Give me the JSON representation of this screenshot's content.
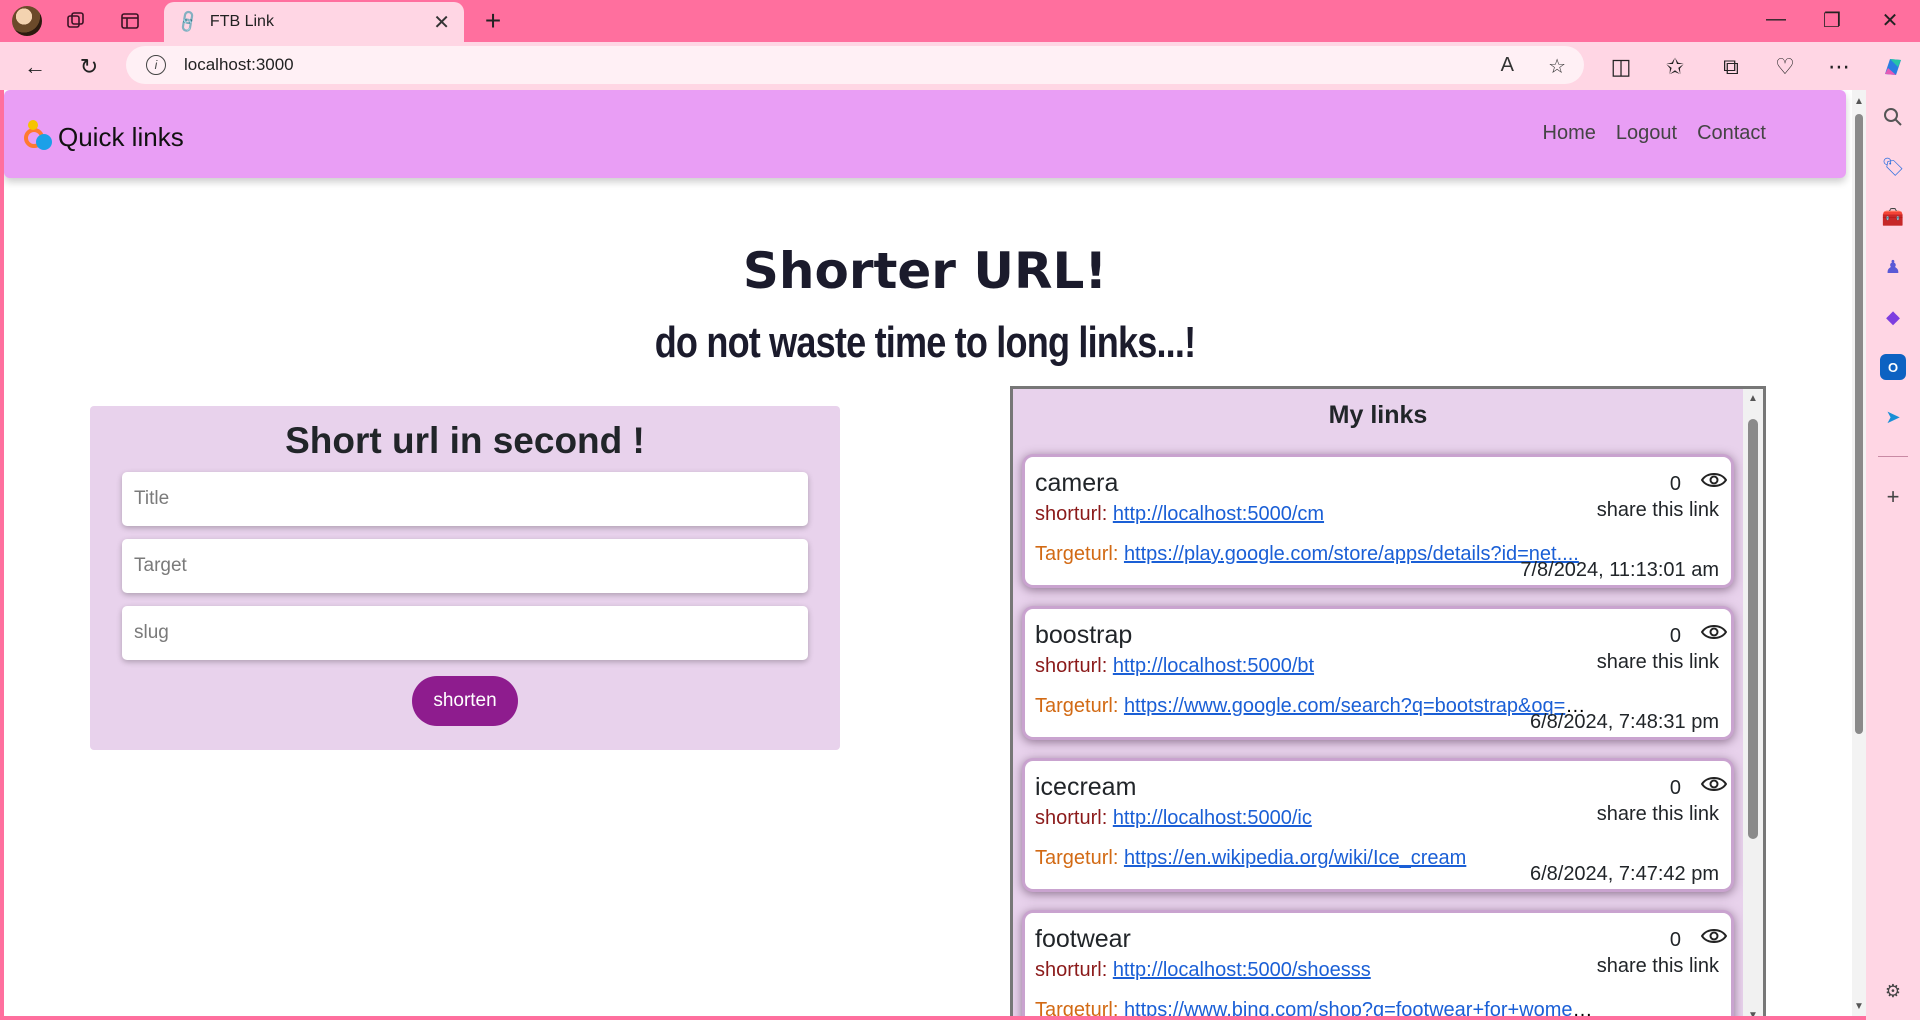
{
  "browser": {
    "tab_title": "FTB Link",
    "address": "localhost:3000",
    "new_tab_symbol": "+",
    "tab_close_symbol": "✕"
  },
  "site": {
    "brand": "Quick links",
    "menu": [
      "Home",
      "Logout",
      "Contact"
    ],
    "hero_title": "Shorter URL!",
    "hero_subtitle": "do not waste time to long links...!",
    "colors": {
      "header": "#e99ef5",
      "panel": "#e8d2ec",
      "button": "#8e1c8e"
    }
  },
  "form": {
    "title": "Short url in second !",
    "title_placeholder": "Title",
    "target_placeholder": "Target",
    "slug_placeholder": "slug",
    "submit_label": "shorten"
  },
  "links": {
    "title": "My links",
    "short_label": "shorturl:",
    "target_label": "Targeturl:",
    "share_label": "share this link",
    "items": [
      {
        "title": "camera",
        "count": "0",
        "short": "http://localhost:5000/cm",
        "target": "https://play.google.com/store/apps/details?id=net....",
        "date": "7/8/2024, 11:13:01 am"
      },
      {
        "title": "boostrap",
        "count": "0",
        "short": "http://localhost:5000/bt",
        "target": "https://www.google.com/search?q=bootstrap&oq=&gs_l...",
        "date": "6/8/2024, 7:48:31 pm"
      },
      {
        "title": "icecream",
        "count": "0",
        "short": "http://localhost:5000/ic",
        "target": "https://en.wikipedia.org/wiki/Ice_cream",
        "date": "6/8/2024, 7:47:42 pm"
      },
      {
        "title": "footwear",
        "count": "0",
        "short": "http://localhost:5000/shoesss",
        "target": "https://www.bing.com/shop?q=footwear+for+women&FOR...",
        "date": ""
      }
    ]
  }
}
